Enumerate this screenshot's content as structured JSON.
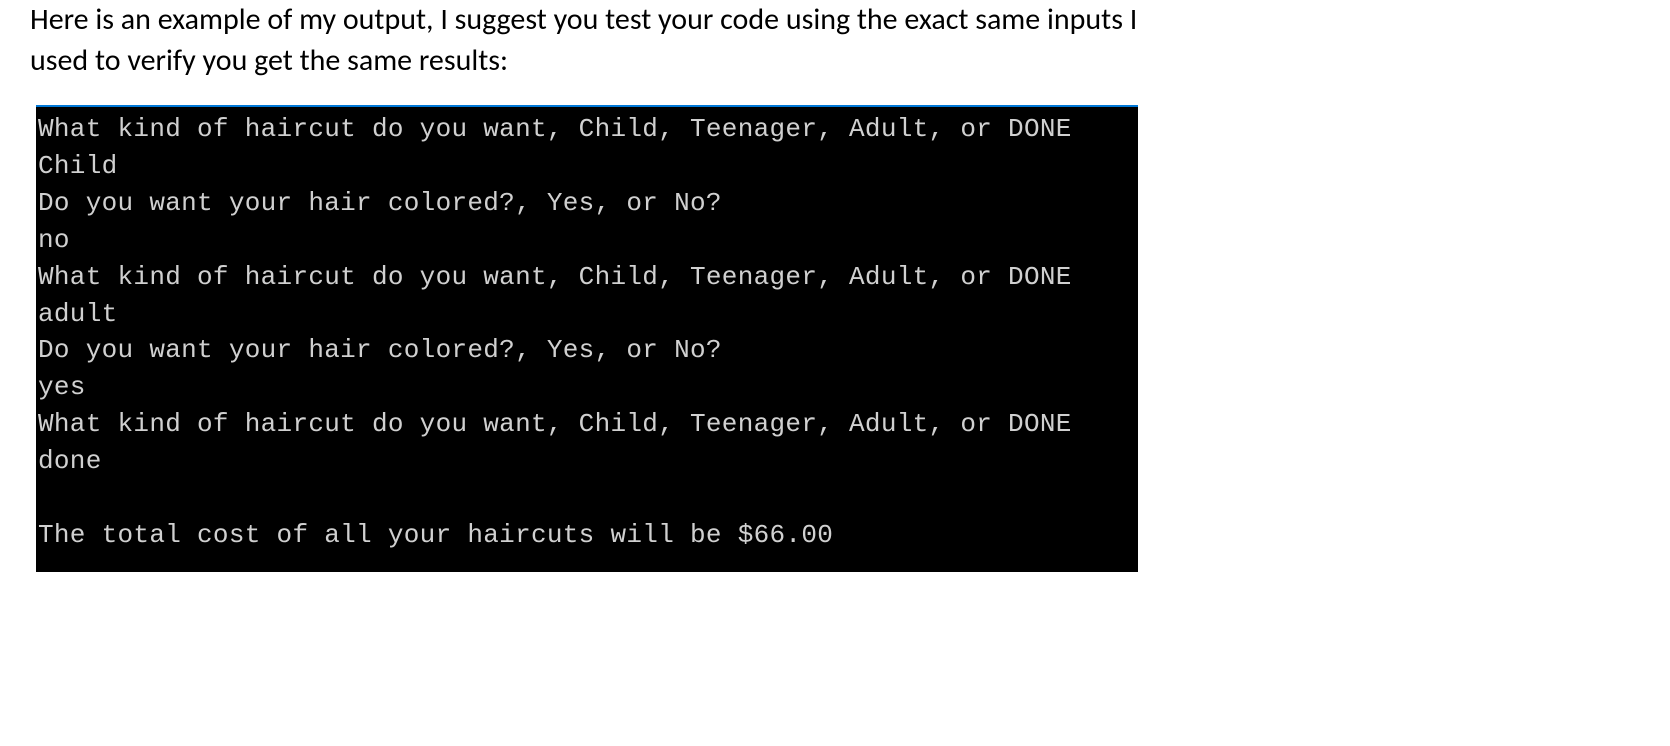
{
  "instruction": {
    "line1": "Here is an example of my output, I suggest you test your code using the exact same inputs I",
    "line2": "used to verify you get the same results:"
  },
  "console": {
    "lines": [
      "What kind of haircut do you want, Child, Teenager, Adult, or DONE",
      "Child",
      "Do you want your hair colored?, Yes, or No?",
      "no",
      "What kind of haircut do you want, Child, Teenager, Adult, or DONE",
      "adult",
      "Do you want your hair colored?, Yes, or No?",
      "yes",
      "What kind of haircut do you want, Child, Teenager, Adult, or DONE",
      "done",
      "",
      "The total cost of all your haircuts will be $66.00"
    ]
  }
}
